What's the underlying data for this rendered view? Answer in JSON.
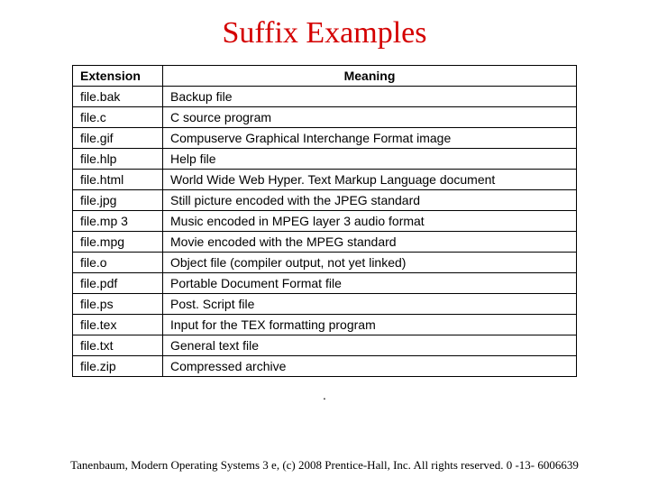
{
  "title": "Suffix Examples",
  "headers": {
    "ext": "Extension",
    "meaning": "Meaning"
  },
  "rows": [
    {
      "ext": "file.bak",
      "meaning": "Backup file"
    },
    {
      "ext": "file.c",
      "meaning": "C source program"
    },
    {
      "ext": "file.gif",
      "meaning": "Compuserve Graphical Interchange Format image"
    },
    {
      "ext": "file.hlp",
      "meaning": "Help file"
    },
    {
      "ext": "file.html",
      "meaning": "World Wide Web Hyper. Text Markup Language document"
    },
    {
      "ext": "file.jpg",
      "meaning": "Still picture encoded with the JPEG standard"
    },
    {
      "ext": "file.mp 3",
      "meaning": "Music encoded in MPEG layer 3 audio format"
    },
    {
      "ext": "file.mpg",
      "meaning": "Movie encoded with the MPEG standard"
    },
    {
      "ext": "file.o",
      "meaning": "Object file (compiler output, not yet linked)"
    },
    {
      "ext": "file.pdf",
      "meaning": "Portable Document Format file"
    },
    {
      "ext": "file.ps",
      "meaning": "Post. Script file"
    },
    {
      "ext": "file.tex",
      "meaning": "Input for the TEX formatting program"
    },
    {
      "ext": "file.txt",
      "meaning": "General text file"
    },
    {
      "ext": "file.zip",
      "meaning": "Compressed archive"
    }
  ],
  "caption_dot": ".",
  "footer": "Tanenbaum, Modern Operating Systems 3 e, (c) 2008 Prentice-Hall, Inc. All rights reserved. 0 -13- 6006639"
}
